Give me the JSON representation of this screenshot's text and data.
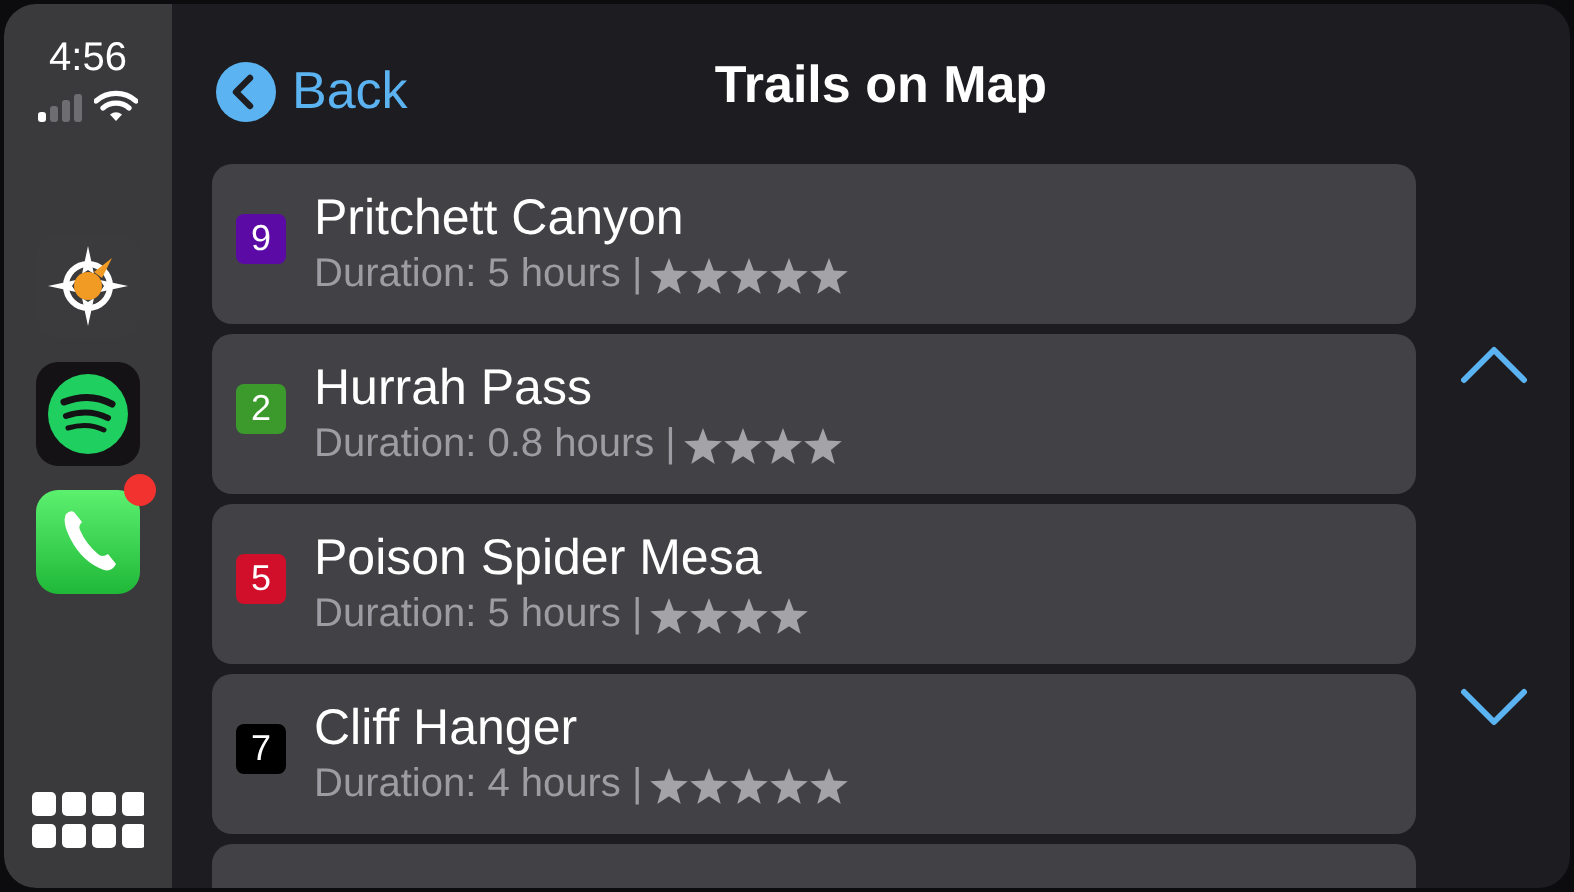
{
  "status": {
    "time": "4:56"
  },
  "header": {
    "back": "Back",
    "title": "Trails on Map"
  },
  "trails": [
    {
      "number": "9",
      "color": "#5b0aa6",
      "name": "Pritchett Canyon",
      "duration": "Duration: 5 hours |",
      "stars": 5
    },
    {
      "number": "2",
      "color": "#3c9a2c",
      "name": "Hurrah Pass",
      "duration": "Duration: 0.8 hours |",
      "stars": 4
    },
    {
      "number": "5",
      "color": "#d20f2b",
      "name": "Poison Spider Mesa",
      "duration": "Duration: 5 hours |",
      "stars": 4
    },
    {
      "number": "7",
      "color": "#000000",
      "name": "Cliff Hanger",
      "duration": "Duration: 4 hours |",
      "stars": 5
    }
  ]
}
